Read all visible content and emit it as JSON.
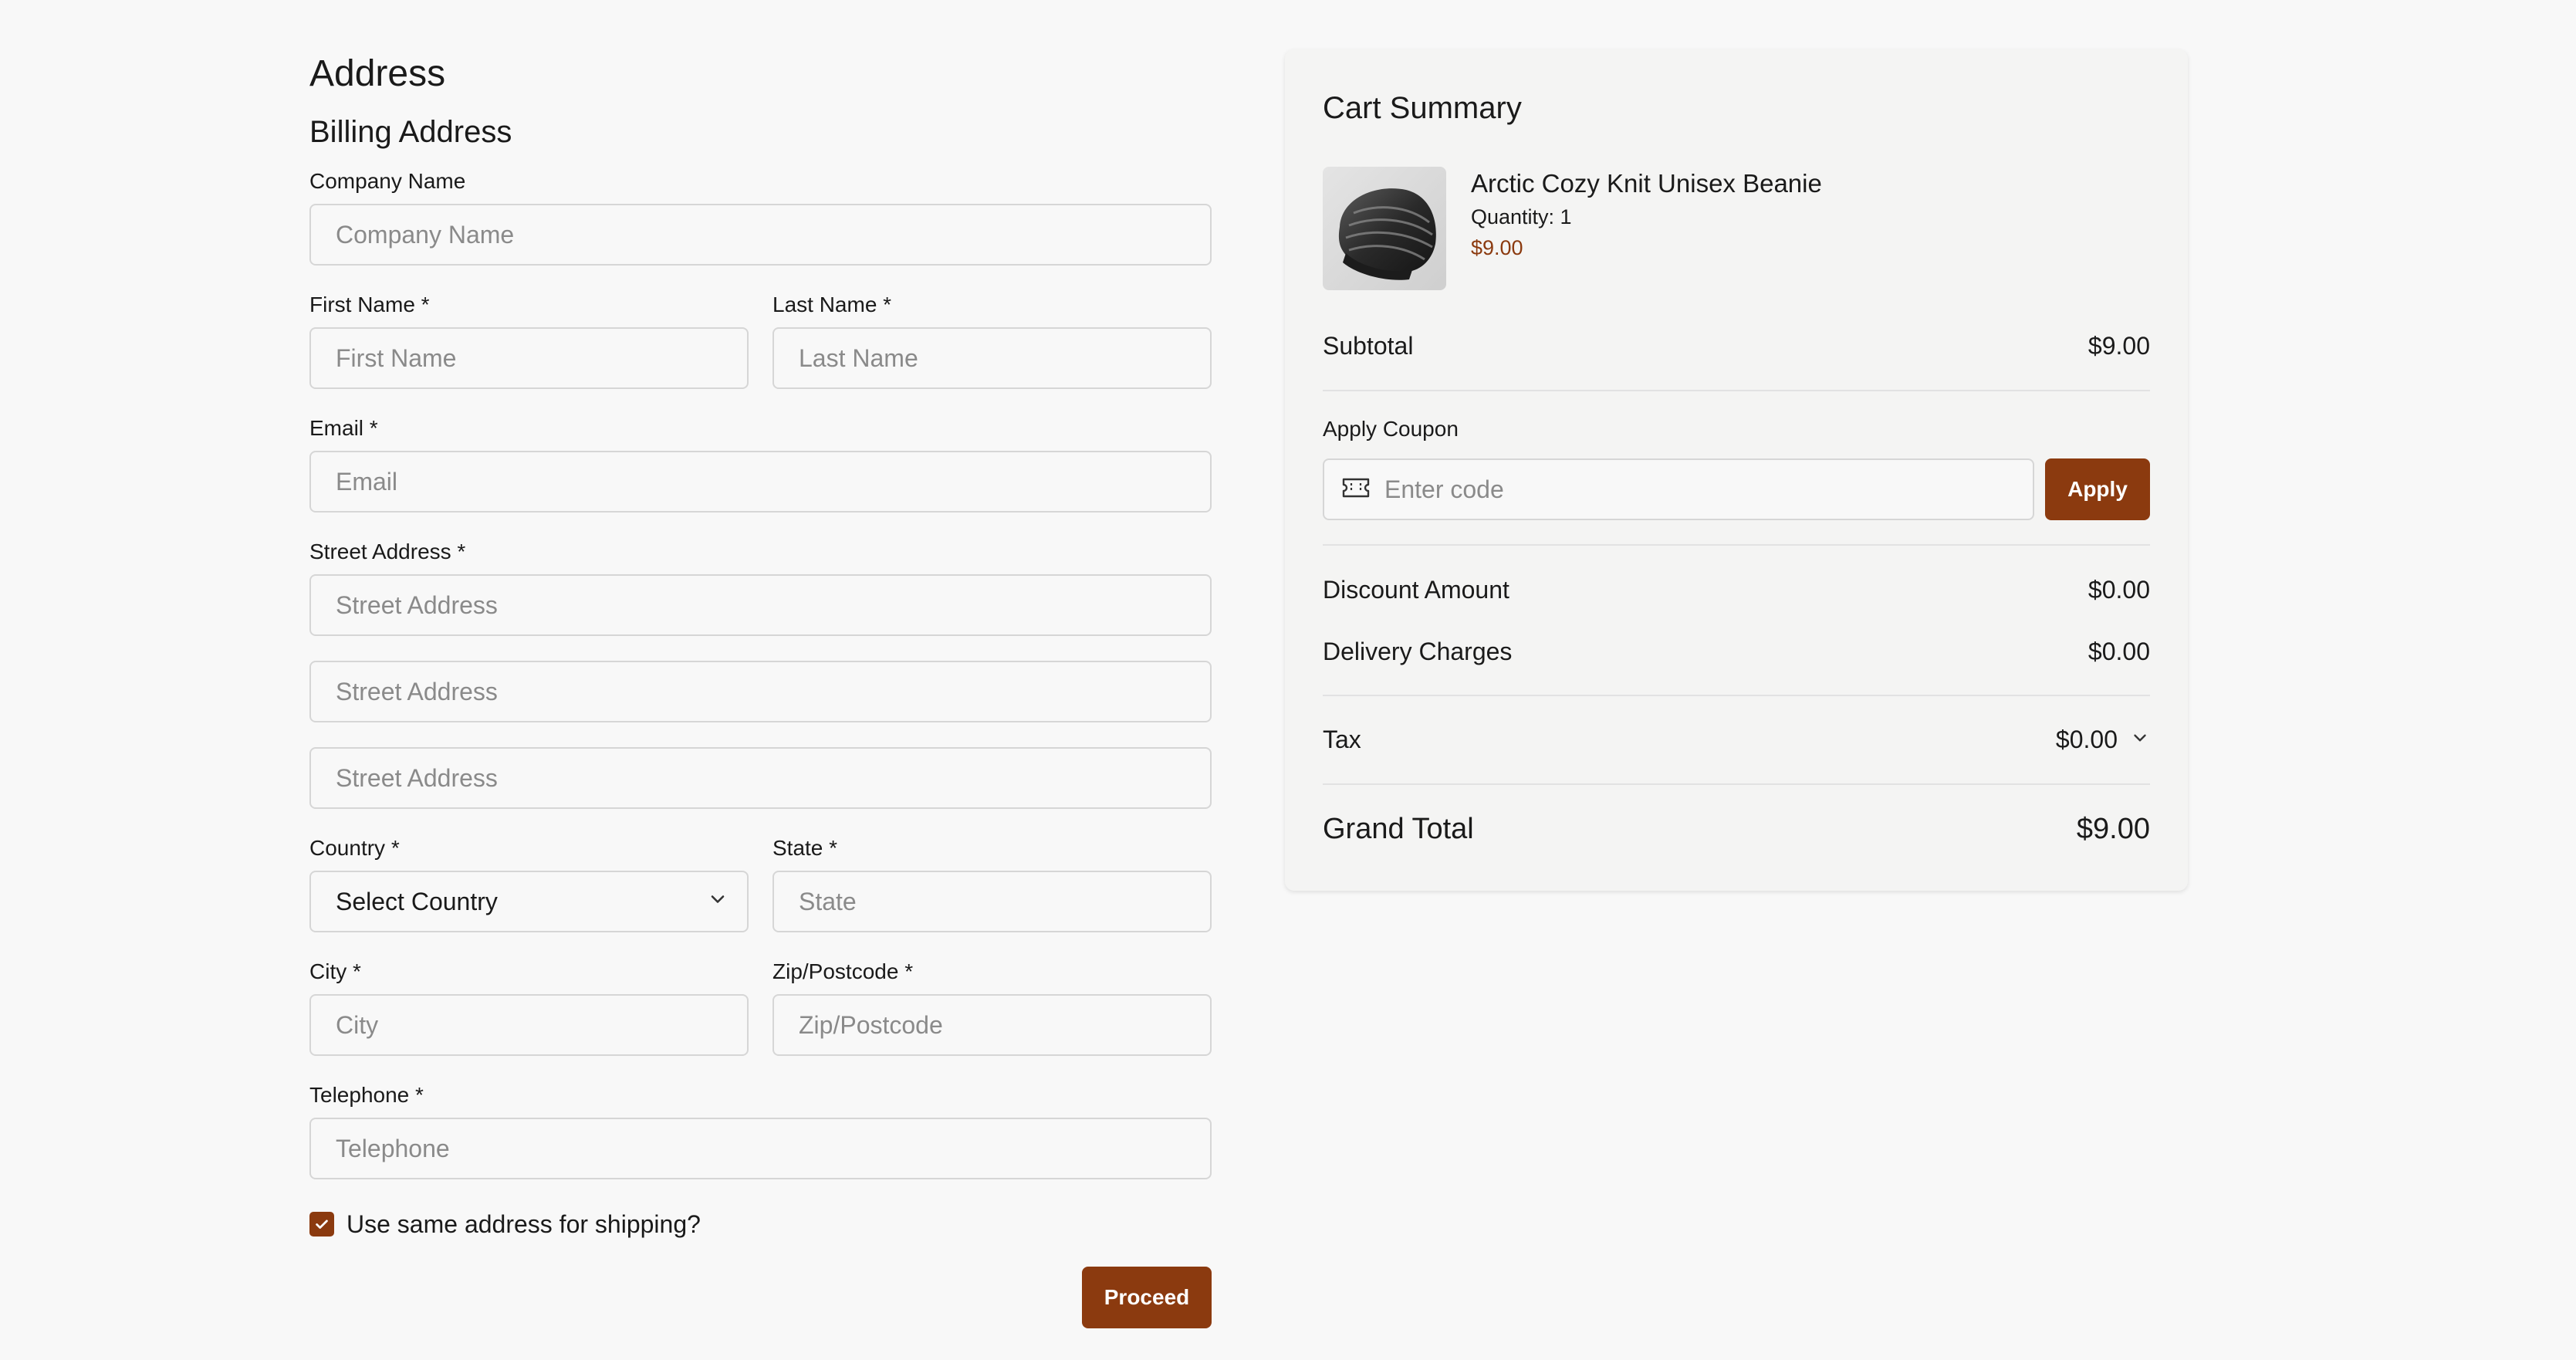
{
  "form": {
    "heading": "Address",
    "subheading": "Billing Address",
    "company": {
      "label": "Company Name",
      "placeholder": "Company Name"
    },
    "first_name": {
      "label": "First Name *",
      "placeholder": "First Name"
    },
    "last_name": {
      "label": "Last Name *",
      "placeholder": "Last Name"
    },
    "email": {
      "label": "Email *",
      "placeholder": "Email"
    },
    "street": {
      "label": "Street Address *",
      "placeholder_1": "Street Address",
      "placeholder_2": "Street Address",
      "placeholder_3": "Street Address"
    },
    "country": {
      "label": "Country *",
      "value": "Select Country"
    },
    "state": {
      "label": "State *",
      "placeholder": "State"
    },
    "city": {
      "label": "City *",
      "placeholder": "City"
    },
    "zip": {
      "label": "Zip/Postcode *",
      "placeholder": "Zip/Postcode"
    },
    "telephone": {
      "label": "Telephone *",
      "placeholder": "Telephone"
    },
    "same_shipping": {
      "label": "Use same address for shipping?",
      "checked": true
    },
    "proceed_label": "Proceed"
  },
  "cart": {
    "title": "Cart Summary",
    "item": {
      "name": "Arctic Cozy Knit Unisex Beanie",
      "quantity": "Quantity: 1",
      "price": "$9.00",
      "image_icon": "beanie-image"
    },
    "subtotal": {
      "label": "Subtotal",
      "value": "$9.00"
    },
    "coupon": {
      "label": "Apply Coupon",
      "placeholder": "Enter code",
      "button": "Apply",
      "icon": "ticket-icon"
    },
    "discount": {
      "label": "Discount Amount",
      "value": "$0.00"
    },
    "delivery": {
      "label": "Delivery Charges",
      "value": "$0.00"
    },
    "tax": {
      "label": "Tax",
      "value": "$0.00"
    },
    "grand_total": {
      "label": "Grand Total",
      "value": "$9.00"
    }
  },
  "colors": {
    "accent": "#8b3a0f",
    "background": "#f8f8f8",
    "panel": "#f4f4f3",
    "border": "#d6d6d6",
    "placeholder": "#8a8a8a"
  }
}
